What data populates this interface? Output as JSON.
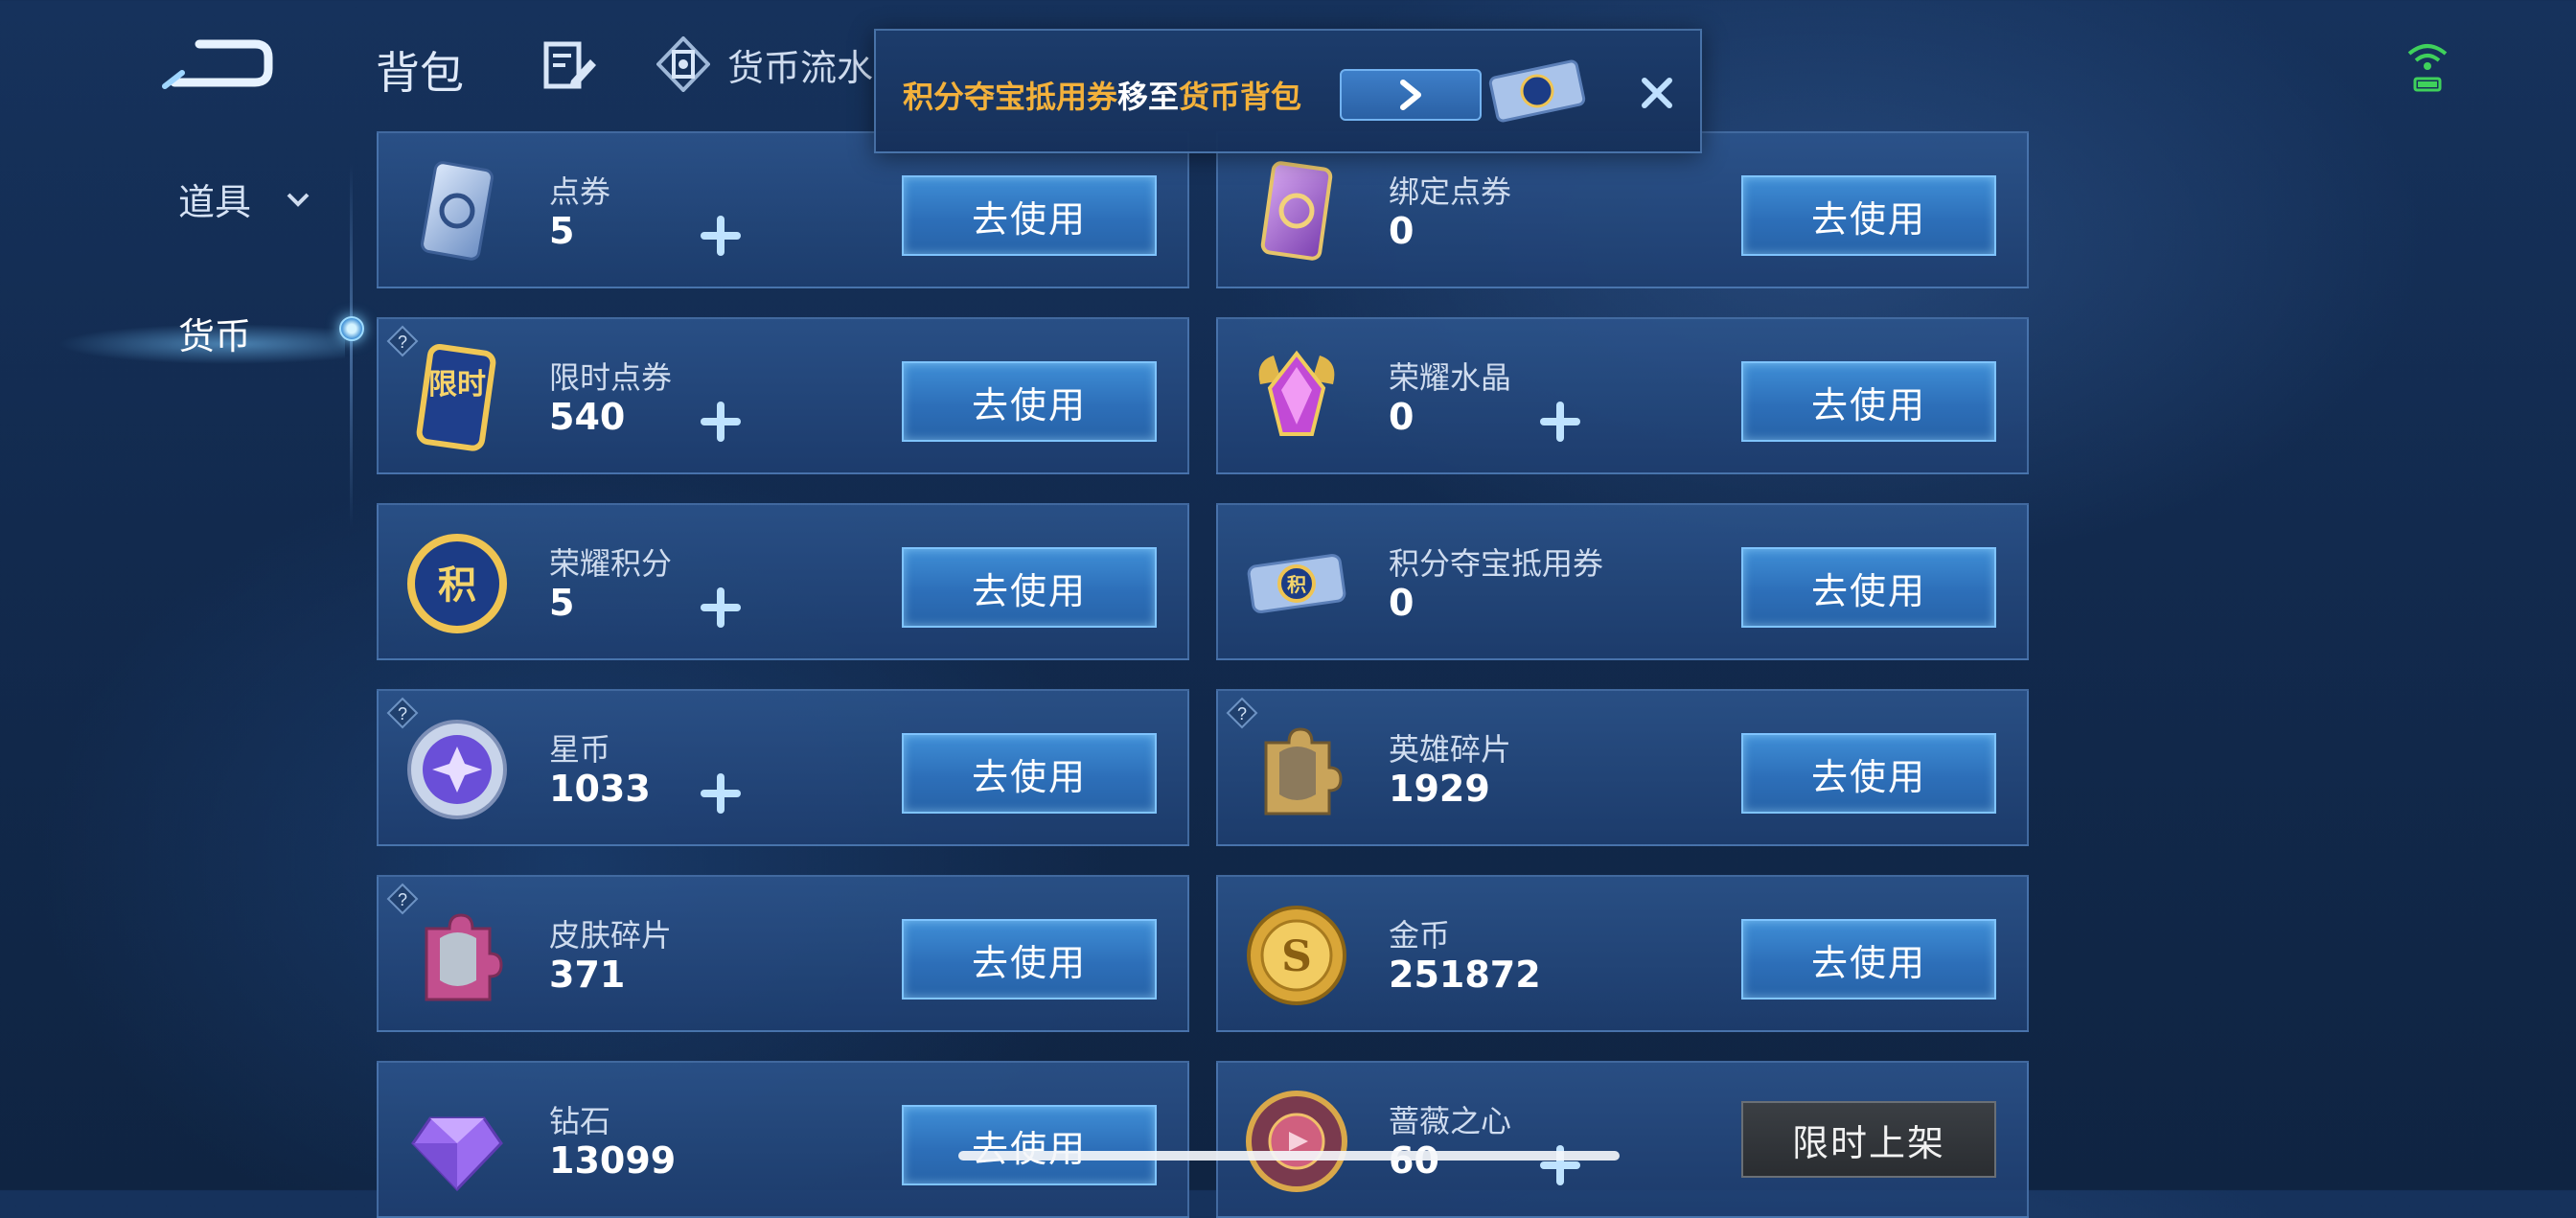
{
  "header": {
    "title": "背包",
    "flow_tab_label": "货币流水"
  },
  "sidebar": {
    "items": [
      {
        "label": "道具",
        "has_chevron": true
      },
      {
        "label": "货币",
        "active": true
      }
    ]
  },
  "toast": {
    "part1": "积分夺宝抵用券",
    "part2": "移至",
    "part3": "货币背包",
    "highlight_color": "#f3b13b"
  },
  "cards": [
    {
      "name": "点券",
      "count": "5",
      "button": "去使用",
      "icon": "ticket-icon"
    },
    {
      "name": "绑定点券",
      "count": "0",
      "button": "去使用",
      "icon": "bound-ticket-icon"
    },
    {
      "name": "限时点券",
      "count": "540",
      "button": "去使用",
      "icon": "limited-ticket-icon",
      "badge": "限时"
    },
    {
      "name": "荣耀水晶",
      "count": "0",
      "button": "去使用",
      "icon": "crystal-icon"
    },
    {
      "name": "荣耀积分",
      "count": "5",
      "button": "去使用",
      "icon": "points-icon",
      "badge": "积"
    },
    {
      "name": "积分夺宝抵用券",
      "count": "0",
      "button": "去使用",
      "icon": "voucher-icon",
      "badge": "积"
    },
    {
      "name": "星币",
      "count": "1033",
      "button": "去使用",
      "icon": "star-coin-icon"
    },
    {
      "name": "英雄碎片",
      "count": "1929",
      "button": "去使用",
      "icon": "hero-fragment-icon"
    },
    {
      "name": "皮肤碎片",
      "count": "371",
      "button": "去使用",
      "icon": "skin-fragment-icon"
    },
    {
      "name": "金币",
      "count": "251872",
      "button": "去使用",
      "icon": "gold-coin-icon"
    },
    {
      "name": "钻石",
      "count": "13099",
      "button": "去使用",
      "icon": "diamond-icon"
    },
    {
      "name": "蔷薇之心",
      "count": "60",
      "button": "限时上架",
      "icon": "rose-heart-icon"
    }
  ],
  "colors": {
    "button_blue": "#3f8ed6",
    "toast_highlight": "#f3b13b",
    "background": "#16325c"
  }
}
